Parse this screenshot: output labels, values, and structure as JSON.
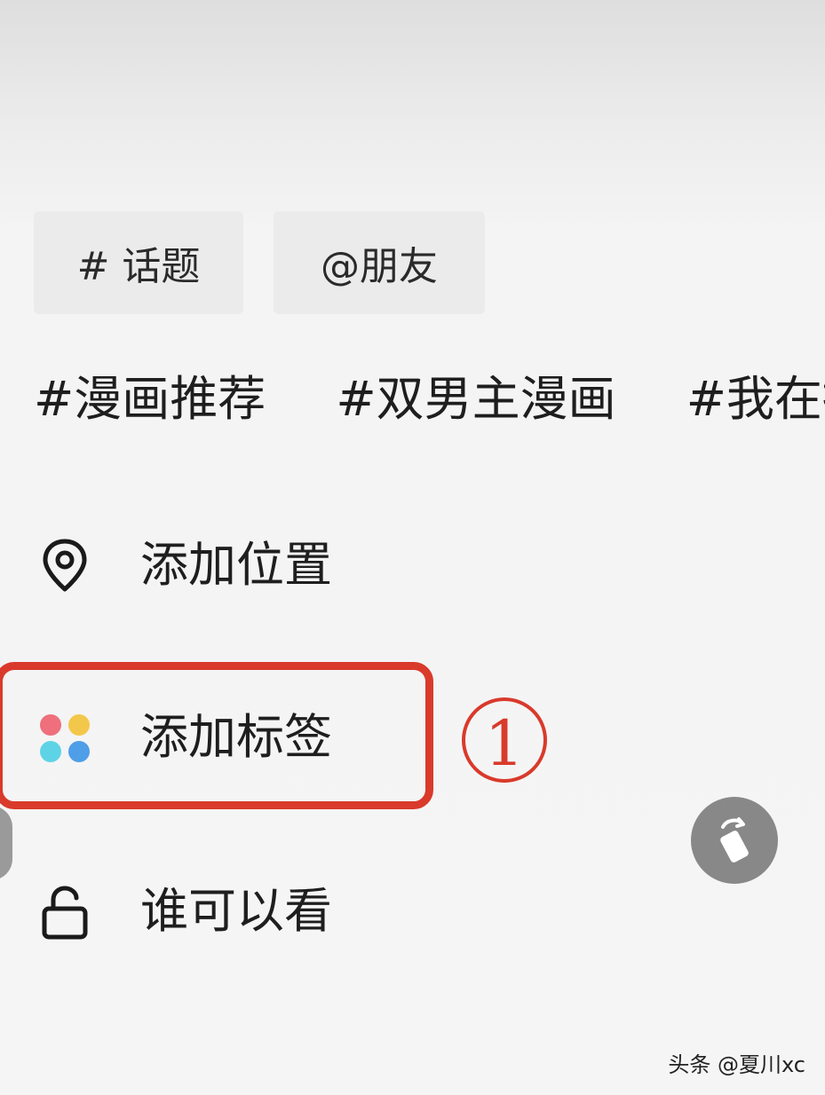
{
  "chips": {
    "topic_label": "# 话题",
    "friend_label": "@朋友"
  },
  "hashtags": [
    "#漫画推荐",
    "#双男主漫画",
    "#我在搞"
  ],
  "menu": {
    "location_label": "添加位置",
    "tag_label": "添加标签",
    "visibility_label": "谁可以看"
  },
  "annotation": {
    "step_marker": "1"
  },
  "icons": {
    "location": "location-pin-icon",
    "tag": "four-dots-icon",
    "visibility": "unlock-icon",
    "floating": "rotate-screen-icon"
  },
  "colors": {
    "highlight": "#d93a2b",
    "dot_red": "#ef6f7c",
    "dot_yellow": "#f3c74a",
    "dot_cyan": "#5fd3e6",
    "dot_blue": "#4f9ee8"
  },
  "watermark": "头条 @夏川xc"
}
